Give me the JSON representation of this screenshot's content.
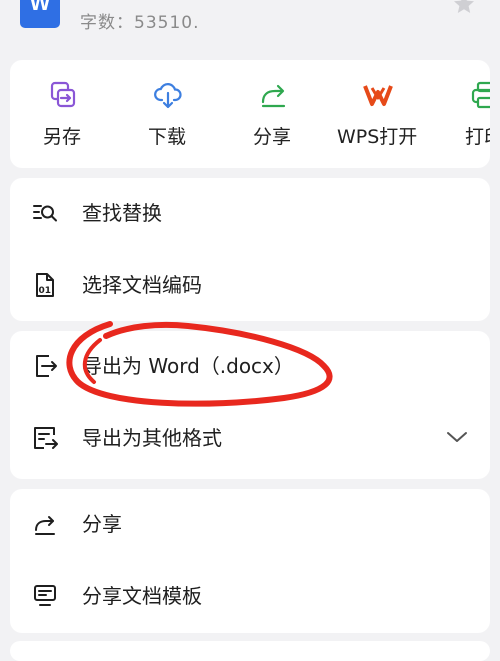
{
  "header": {
    "app_logo_letter": "W",
    "word_count": "字数：53510."
  },
  "quick_actions": [
    {
      "label": "另存",
      "icon": "save-as-icon",
      "color": "#8a56d6"
    },
    {
      "label": "下载",
      "icon": "cloud-download-icon",
      "color": "#3d7fe0"
    },
    {
      "label": "分享",
      "icon": "share-icon",
      "color": "#2fa84f"
    },
    {
      "label": "WPS打开",
      "icon": "wps-logo-icon",
      "color": "#e64a19"
    },
    {
      "label": "打印",
      "icon": "print-icon",
      "color": "#2fa84f"
    }
  ],
  "search_group": {
    "items": [
      {
        "label": "查找替换",
        "icon": "find-replace-icon"
      },
      {
        "label": "选择文档编码",
        "icon": "document-encoding-icon"
      }
    ]
  },
  "export_group": {
    "items": [
      {
        "label": "导出为 Word（.docx）",
        "icon": "export-icon"
      },
      {
        "label": "导出为其他格式",
        "icon": "export-format-icon",
        "expand_icon": "chevron-down-icon"
      }
    ]
  },
  "share_group": {
    "items": [
      {
        "label": "分享",
        "icon": "share-icon"
      },
      {
        "label": "分享文档模板",
        "icon": "template-icon"
      }
    ]
  },
  "annotation": {
    "color": "#e8281e",
    "shape": "hand-drawn ellipse around 导出为 Word（.docx）"
  },
  "colors": {
    "background": "#f2f2f4",
    "card": "#ffffff",
    "word_blue": "#2f6fe4",
    "text": "#1f1f1f",
    "muted": "#8a8a8a"
  }
}
